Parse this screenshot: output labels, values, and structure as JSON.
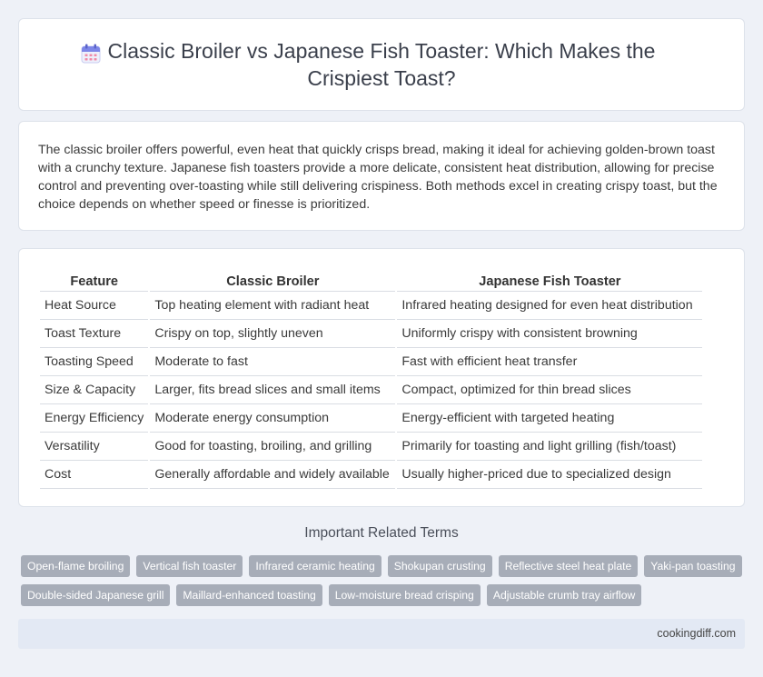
{
  "header": {
    "title": "Classic Broiler vs Japanese Fish Toaster: Which Makes the Crispiest Toast?",
    "icon": "calendar-icon"
  },
  "summary": "The classic broiler offers powerful, even heat that quickly crisps bread, making it ideal for achieving golden-brown toast with a crunchy texture. Japanese fish toasters provide a more delicate, consistent heat distribution, allowing for precise control and preventing over-toasting while still delivering crispiness. Both methods excel in creating crispy toast, but the choice depends on whether speed or finesse is prioritized.",
  "table": {
    "headers": [
      "Feature",
      "Classic Broiler",
      "Japanese Fish Toaster"
    ],
    "rows": [
      [
        "Heat Source",
        "Top heating element with radiant heat",
        "Infrared heating designed for even heat distribution"
      ],
      [
        "Toast Texture",
        "Crispy on top, slightly uneven",
        "Uniformly crispy with consistent browning"
      ],
      [
        "Toasting Speed",
        "Moderate to fast",
        "Fast with efficient heat transfer"
      ],
      [
        "Size & Capacity",
        "Larger, fits bread slices and small items",
        "Compact, optimized for thin bread slices"
      ],
      [
        "Energy Efficiency",
        "Moderate energy consumption",
        "Energy-efficient with targeted heating"
      ],
      [
        "Versatility",
        "Good for toasting, broiling, and grilling",
        "Primarily for toasting and light grilling (fish/toast)"
      ],
      [
        "Cost",
        "Generally affordable and widely available",
        "Usually higher-priced due to specialized design"
      ]
    ]
  },
  "related": {
    "title": "Important Related Terms",
    "tags": [
      "Open-flame broiling",
      "Vertical fish toaster",
      "Infrared ceramic heating",
      "Shokupan crusting",
      "Reflective steel heat plate",
      "Yaki-pan toasting",
      "Double-sided Japanese grill",
      "Maillard-enhanced toasting",
      "Low-moisture bread crisping",
      "Adjustable crumb tray airflow"
    ]
  },
  "footer": {
    "site": "cookingdiff.com"
  },
  "colors": {
    "background": "#eef1f7",
    "tag": "#a7adb8",
    "footer": "#e3e9f4"
  }
}
